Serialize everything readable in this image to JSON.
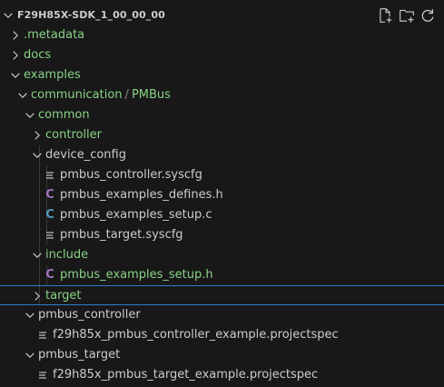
{
  "explorer": {
    "title": "F29H85X-SDK_1_00_00_00",
    "actions": [
      {
        "name": "new-file-icon"
      },
      {
        "name": "new-folder-icon"
      },
      {
        "name": "refresh-icon"
      }
    ]
  },
  "tree": {
    "items": [
      {
        "label": ".metadata",
        "kind": "folder",
        "expanded": false,
        "depth": 1,
        "color": "green"
      },
      {
        "label": "docs",
        "kind": "folder",
        "expanded": false,
        "depth": 1,
        "color": "green"
      },
      {
        "label": "examples",
        "kind": "folder",
        "expanded": true,
        "depth": 1,
        "color": "green"
      },
      {
        "label": "communication",
        "label2": "PMBus",
        "kind": "folder",
        "expanded": true,
        "depth": 2,
        "color": "green"
      },
      {
        "label": "common",
        "kind": "folder",
        "expanded": true,
        "depth": 3,
        "color": "green"
      },
      {
        "label": "controller",
        "kind": "folder",
        "expanded": false,
        "depth": 4,
        "color": "green"
      },
      {
        "label": "device_config",
        "kind": "folder",
        "expanded": true,
        "depth": 4,
        "color": "white"
      },
      {
        "label": "pmbus_controller.syscfg",
        "kind": "file-lines",
        "depth": 5,
        "color": "white"
      },
      {
        "label": "pmbus_examples_defines.h",
        "kind": "file-c",
        "depth": 5,
        "color": "white"
      },
      {
        "label": "pmbus_examples_setup.c",
        "kind": "file-c-blue",
        "depth": 5,
        "color": "white"
      },
      {
        "label": "pmbus_target.syscfg",
        "kind": "file-lines",
        "depth": 5,
        "color": "white"
      },
      {
        "label": "include",
        "kind": "folder",
        "expanded": true,
        "depth": 4,
        "color": "green"
      },
      {
        "label": "pmbus_examples_setup.h",
        "kind": "file-c",
        "depth": 5,
        "color": "green"
      },
      {
        "label": "target",
        "kind": "folder",
        "expanded": false,
        "depth": 4,
        "color": "green",
        "focused": true
      },
      {
        "label": "pmbus_controller",
        "kind": "folder",
        "expanded": true,
        "depth": 3,
        "color": "white"
      },
      {
        "label": "f29h85x_pmbus_controller_example.projectspec",
        "kind": "file-lines",
        "depth": 4,
        "color": "white"
      },
      {
        "label": "pmbus_target",
        "kind": "folder",
        "expanded": true,
        "depth": 3,
        "color": "white"
      },
      {
        "label": "f29h85x_pmbus_target_example.projectspec",
        "kind": "file-lines",
        "depth": 4,
        "color": "white"
      }
    ]
  },
  "colors": {
    "background": "#181818",
    "green_text": "#89d185",
    "default_text": "#cccccc",
    "focus_border": "#2b7ecf",
    "c_header_icon": "#a074c4",
    "c_source_icon": "#519aba"
  },
  "icons": {
    "chevron_right": "chevron-right-icon",
    "chevron_down": "chevron-down-icon",
    "lines_file": "file-lines-icon",
    "c_file": "c-file-icon"
  }
}
